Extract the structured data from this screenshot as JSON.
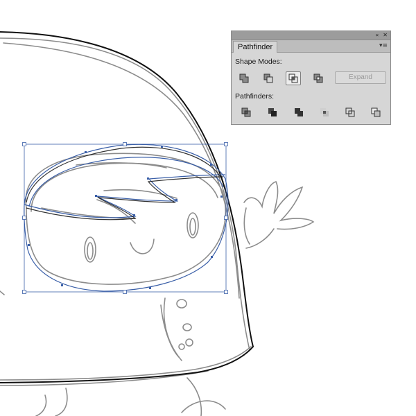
{
  "panel": {
    "collapse_glyph": "«",
    "close_glyph": "✕",
    "tab_label": "Pathfinder",
    "menu_glyph": "▾≡",
    "shape_modes_label": "Shape Modes:",
    "pathfinders_label": "Pathfinders:",
    "expand_label": "Expand",
    "shape_modes": [
      {
        "icon": "unite-icon",
        "active": false
      },
      {
        "icon": "minus-front-icon",
        "active": false
      },
      {
        "icon": "intersect-icon",
        "active": true
      },
      {
        "icon": "exclude-icon",
        "active": false
      }
    ],
    "pathfinders": [
      {
        "icon": "divide-icon"
      },
      {
        "icon": "trim-icon"
      },
      {
        "icon": "merge-icon"
      },
      {
        "icon": "crop-icon"
      },
      {
        "icon": "outline-icon"
      },
      {
        "icon": "minus-back-icon"
      }
    ]
  },
  "colors": {
    "sketch_stroke": "#8c8c8c",
    "ink_stroke": "#111111",
    "selection": "#3a5fa8",
    "panel_bg": "#d6d6d6"
  }
}
